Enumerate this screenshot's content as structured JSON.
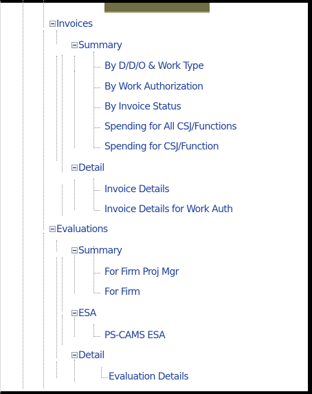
{
  "tree": [
    {
      "label": "Invoices",
      "icon": "collapse-box-icon"
    },
    {
      "label": "Summary",
      "icon": "collapse-box-icon"
    },
    {
      "label": "By D/D/O & Work Type"
    },
    {
      "label": "By Work Authorization"
    },
    {
      "label": "By Invoice Status"
    },
    {
      "label": "Spending for All CSJ/Functions"
    },
    {
      "label": "Spending for CSJ/Function"
    },
    {
      "label": "Detail",
      "icon": "collapse-box-icon"
    },
    {
      "label": "Invoice Details"
    },
    {
      "label": "Invoice Details for Work Auth"
    },
    {
      "label": "Evaluations",
      "icon": "collapse-box-icon"
    },
    {
      "label": "Summary",
      "icon": "collapse-box-icon"
    },
    {
      "label": "For Firm Proj Mgr"
    },
    {
      "label": "For Firm"
    },
    {
      "label": "ESA",
      "icon": "collapse-box-icon"
    },
    {
      "label": "PS-CAMS ESA"
    },
    {
      "label": "Detail",
      "icon": "collapse-box-icon"
    },
    {
      "label": "Evaluation Details"
    }
  ]
}
